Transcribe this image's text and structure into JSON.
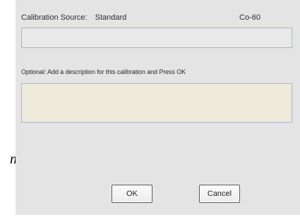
{
  "margin_text": "n",
  "dialog": {
    "source_label": "Calibration Source:",
    "source_value": "Standard",
    "isotope": "Co-60",
    "source_field_value": "",
    "description_prompt": "Optional: Add a description for this calibration and Press OK",
    "description_value": "",
    "ok_label": "OK",
    "cancel_label": "Cancel"
  }
}
